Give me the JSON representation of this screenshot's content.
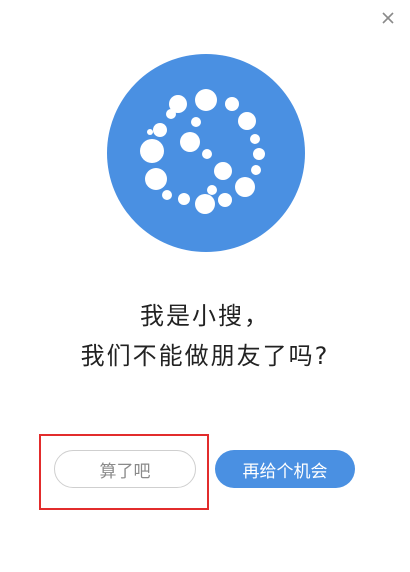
{
  "dialog": {
    "message_line1": "我是小搜，",
    "message_line2": "我们不能做朋友了吗?",
    "cancel_label": "算了吧",
    "retry_label": "再给个机会"
  },
  "icons": {
    "close": "close-icon",
    "logo": "dotted-circle-logo"
  },
  "colors": {
    "logo_blue": "#4a90e2",
    "primary_button": "#4a90e2",
    "highlight_border": "#e22c2c",
    "text": "#222222",
    "cancel_text": "#8a8a8a"
  }
}
